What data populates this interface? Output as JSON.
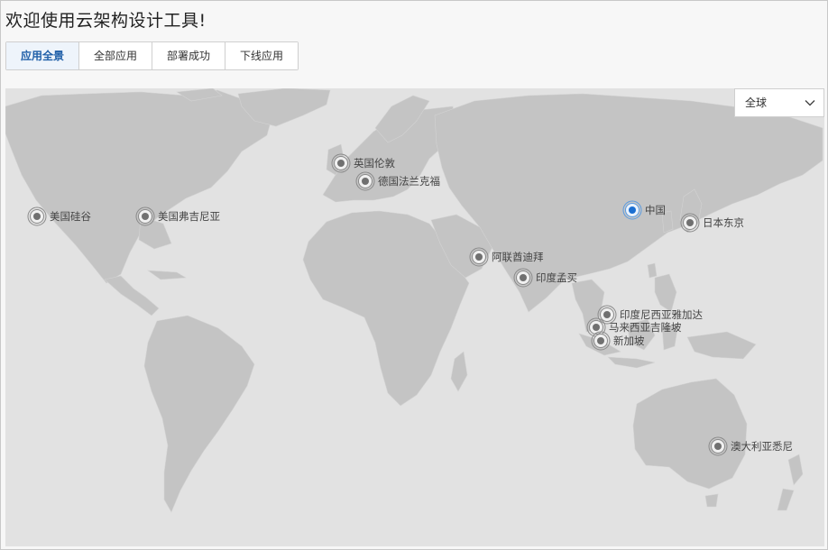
{
  "page": {
    "title": "欢迎使用云架构设计工具!"
  },
  "tabs": [
    {
      "label": "应用全景",
      "active": true
    },
    {
      "label": "全部应用",
      "active": false
    },
    {
      "label": "部署成功",
      "active": false
    },
    {
      "label": "下线应用",
      "active": false
    }
  ],
  "region_select": {
    "value": "全球",
    "icon": "chevron-down-icon"
  },
  "colors": {
    "ocean": "#e2e2e2",
    "land": "#c4c4c4",
    "marker_default": "#707070",
    "marker_active": "#1c6fd1",
    "tab_active_text": "#1f5fa8"
  },
  "locations": [
    {
      "label": "美国硅谷",
      "active": false
    },
    {
      "label": "美国弗吉尼亚",
      "active": false
    },
    {
      "label": "英国伦敦",
      "active": false
    },
    {
      "label": "德国法兰克福",
      "active": false
    },
    {
      "label": "中国",
      "active": true
    },
    {
      "label": "日本东京",
      "active": false
    },
    {
      "label": "阿联酋迪拜",
      "active": false
    },
    {
      "label": "印度孟买",
      "active": false
    },
    {
      "label": "印度尼西亚雅加达",
      "active": false
    },
    {
      "label": "马来西亚吉隆坡",
      "active": false
    },
    {
      "label": "新加坡",
      "active": false
    },
    {
      "label": "澳大利亚悉尼",
      "active": false
    }
  ]
}
